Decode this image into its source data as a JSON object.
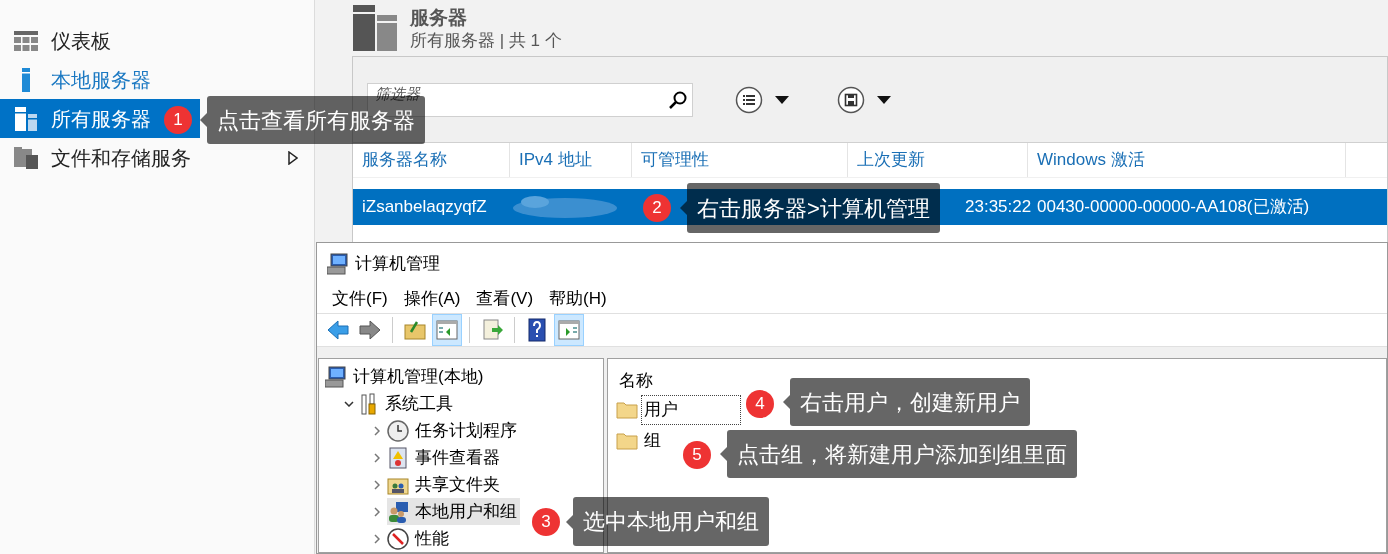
{
  "sidebar": {
    "items": [
      {
        "label": "仪表板",
        "selected": false,
        "hovered": false,
        "expandable": false
      },
      {
        "label": "本地服务器",
        "selected": false,
        "hovered": true,
        "expandable": false
      },
      {
        "label": "所有服务器",
        "selected": true,
        "hovered": false,
        "expandable": false
      },
      {
        "label": "文件和存储服务",
        "selected": false,
        "hovered": false,
        "expandable": true
      }
    ]
  },
  "header": {
    "title": "服务器",
    "subtitle": "所有服务器 | 共 1 个"
  },
  "filter": {
    "placeholder": "筛选器"
  },
  "table": {
    "columns": [
      "服务器名称",
      "IPv4 地址",
      "可管理性",
      "上次更新",
      "Windows 激活"
    ],
    "rows": [
      {
        "server_name": "iZsanbelaqzyqfZ",
        "last_update": "23:35:22",
        "windows_activation": "00430-00000-00000-AA108(已激活)",
        "selected": true
      }
    ]
  },
  "mmc": {
    "title": "计算机管理",
    "menu": [
      "文件(F)",
      "操作(A)",
      "查看(V)",
      "帮助(H)"
    ],
    "toolbar": [
      {
        "pressed": false
      },
      {
        "pressed": false
      },
      {
        "pressed": false
      },
      {
        "pressed": true
      },
      {
        "pressed": false
      },
      {
        "pressed": false
      },
      {
        "pressed": true
      }
    ],
    "tree": [
      {
        "label": "计算机管理(本地)",
        "selected": false,
        "children": [
          {
            "label": "系统工具",
            "expanded": true,
            "selected": false,
            "children": [
              {
                "label": "任务计划程序",
                "expanded": false,
                "selected": false
              },
              {
                "label": "事件查看器",
                "expanded": false,
                "selected": false
              },
              {
                "label": "共享文件夹",
                "expanded": false,
                "selected": false
              },
              {
                "label": "本地用户和组",
                "expanded": false,
                "selected": true
              },
              {
                "label": "性能",
                "expanded": false,
                "selected": false
              }
            ]
          }
        ]
      }
    ],
    "list": {
      "column": "名称",
      "items": [
        {
          "label": "用户",
          "focused": true
        },
        {
          "label": "组",
          "focused": false
        }
      ]
    }
  },
  "callouts": [
    {
      "number": "1",
      "text": "点击查看所有服务器"
    },
    {
      "number": "2",
      "text": "右击服务器>计算机管理"
    },
    {
      "number": "3",
      "text": "选中本地用户和组"
    },
    {
      "number": "4",
      "text": "右击用户，创建新用户"
    },
    {
      "number": "5",
      "text": "点击组，将新建用户添加到组里面"
    }
  ]
}
